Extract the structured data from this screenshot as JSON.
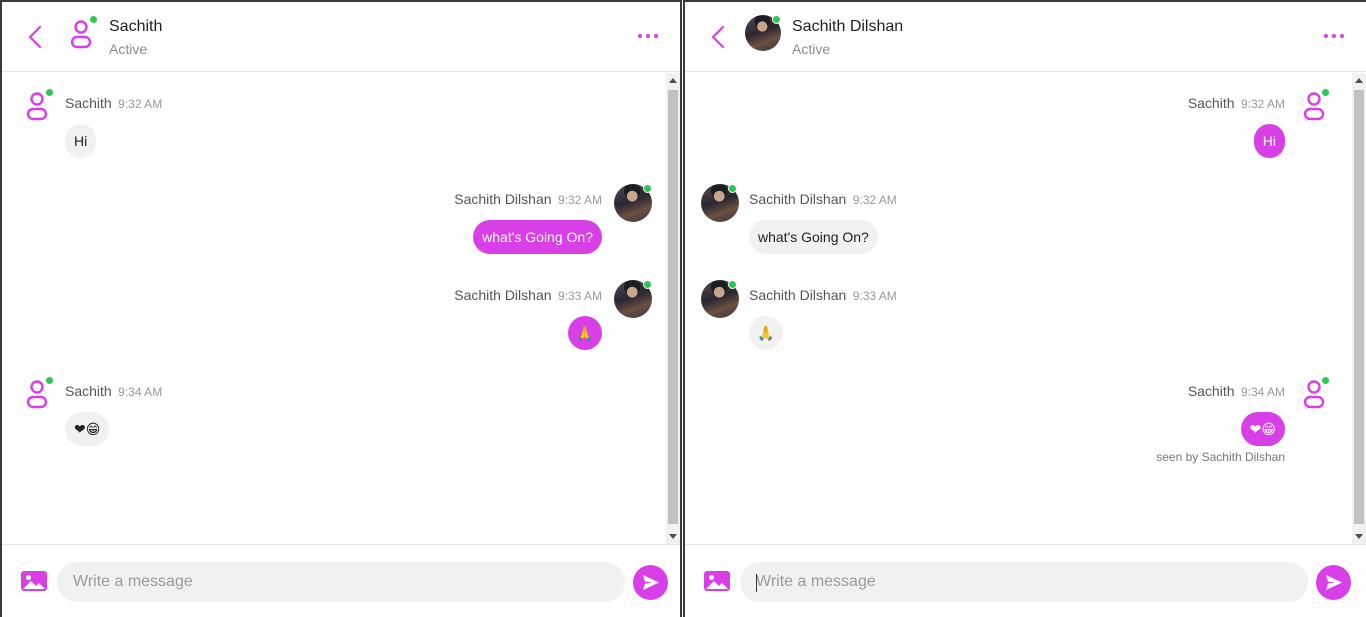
{
  "colors": {
    "accent": "#d93fe6",
    "online": "#31c653",
    "bubble_in": "#f1f1f1"
  },
  "left_panel": {
    "header": {
      "name": "Sachith",
      "status": "Active",
      "avatar_icon": "user-outline-icon"
    },
    "messages": [
      {
        "sender": "Sachith",
        "time": "9:32 AM",
        "text": "Hi"
      },
      {
        "sender": "Sachith Dilshan",
        "time": "9:32 AM",
        "text": "what's Going On?"
      },
      {
        "sender": "Sachith Dilshan",
        "time": "9:33 AM",
        "text": "🙏"
      },
      {
        "sender": "Sachith",
        "time": "9:34 AM",
        "text": "❤😁"
      }
    ],
    "composer": {
      "placeholder": "Write a message"
    }
  },
  "right_panel": {
    "header": {
      "name": "Sachith Dilshan",
      "status": "Active",
      "avatar_icon": "profile-photo"
    },
    "messages": [
      {
        "sender": "Sachith",
        "time": "9:32 AM",
        "text": "Hi"
      },
      {
        "sender": "Sachith Dilshan",
        "time": "9:32 AM",
        "text": "what's Going On?"
      },
      {
        "sender": "Sachith Dilshan",
        "time": "9:33 AM",
        "text": "🙏"
      },
      {
        "sender": "Sachith",
        "time": "9:34 AM",
        "text": "❤😁"
      }
    ],
    "seen_label": "seen by Sachith Dilshan",
    "composer": {
      "placeholder": "Write a message"
    }
  }
}
